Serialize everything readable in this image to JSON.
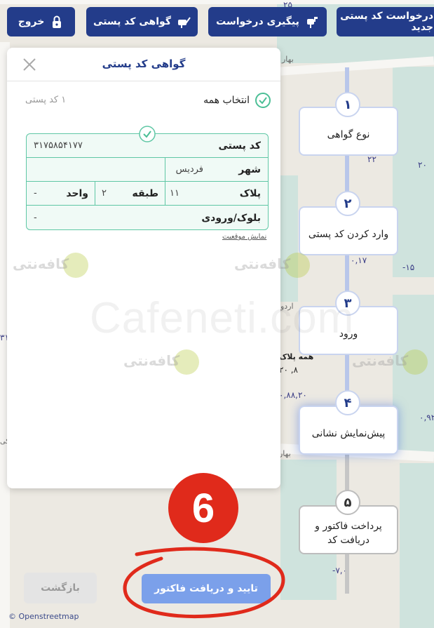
{
  "topbar": {
    "new_request": "درخواست کد پستی جدید",
    "track_request": "پیگیری درخواست",
    "certificate": "گواهی کد پستی",
    "logout": "خروج"
  },
  "map": {
    "numbers": [
      "۲۵",
      "۲۲",
      "۲۰",
      "۰,۱۷",
      "-۱۵",
      "۰,۹۲",
      "-۷,۰",
      "۰,۸۸,۲۰",
      "۲۰ ,۸",
      "۳۱"
    ],
    "streets": [
      "بهار",
      "اردو",
      "بهار"
    ],
    "label": "همه پلاک",
    "side": "شکی",
    "attribution": "© Openstreetmap"
  },
  "steps": [
    {
      "num": "۱",
      "label": "نوع گواهی"
    },
    {
      "num": "۲",
      "label": "وارد کردن کد پستی"
    },
    {
      "num": "۳",
      "label": "ورود"
    },
    {
      "num": "۴",
      "label": "پیش‌نمایش نشانی"
    },
    {
      "num": "۵",
      "label": "پرداخت فاکتور و دریافت کد"
    }
  ],
  "panel": {
    "title": "گواهی کد پستی",
    "select_all": "انتخاب همه",
    "count": "۱ کد پستی",
    "card": {
      "postal_code_label": "کد پستی",
      "postal_code_value": "۳۱۷۵۸۵۴۱۷۷",
      "city_label": "شهر",
      "city_value": "فردیس",
      "plate_label": "پلاک",
      "plate_value": "۱۱",
      "floor_label": "طبقه",
      "floor_value": "۲",
      "unit_label": "واحد",
      "unit_value": "-",
      "block_label": "بلوک/ورودی",
      "block_value": "-"
    },
    "show_location": "نمایش موقعیت"
  },
  "watermark": {
    "big": "Cafeneti.com",
    "small": "کافه‌نتی"
  },
  "buttons": {
    "back": "بازگشت",
    "confirm": "تایید و دریافت فاکتور"
  },
  "annotation": {
    "number": "6"
  },
  "colors": {
    "primary": "#233c8a",
    "accent_green": "#5fc7a5",
    "confirm": "#7ba0ea",
    "annotation_red": "#e02a1b"
  }
}
